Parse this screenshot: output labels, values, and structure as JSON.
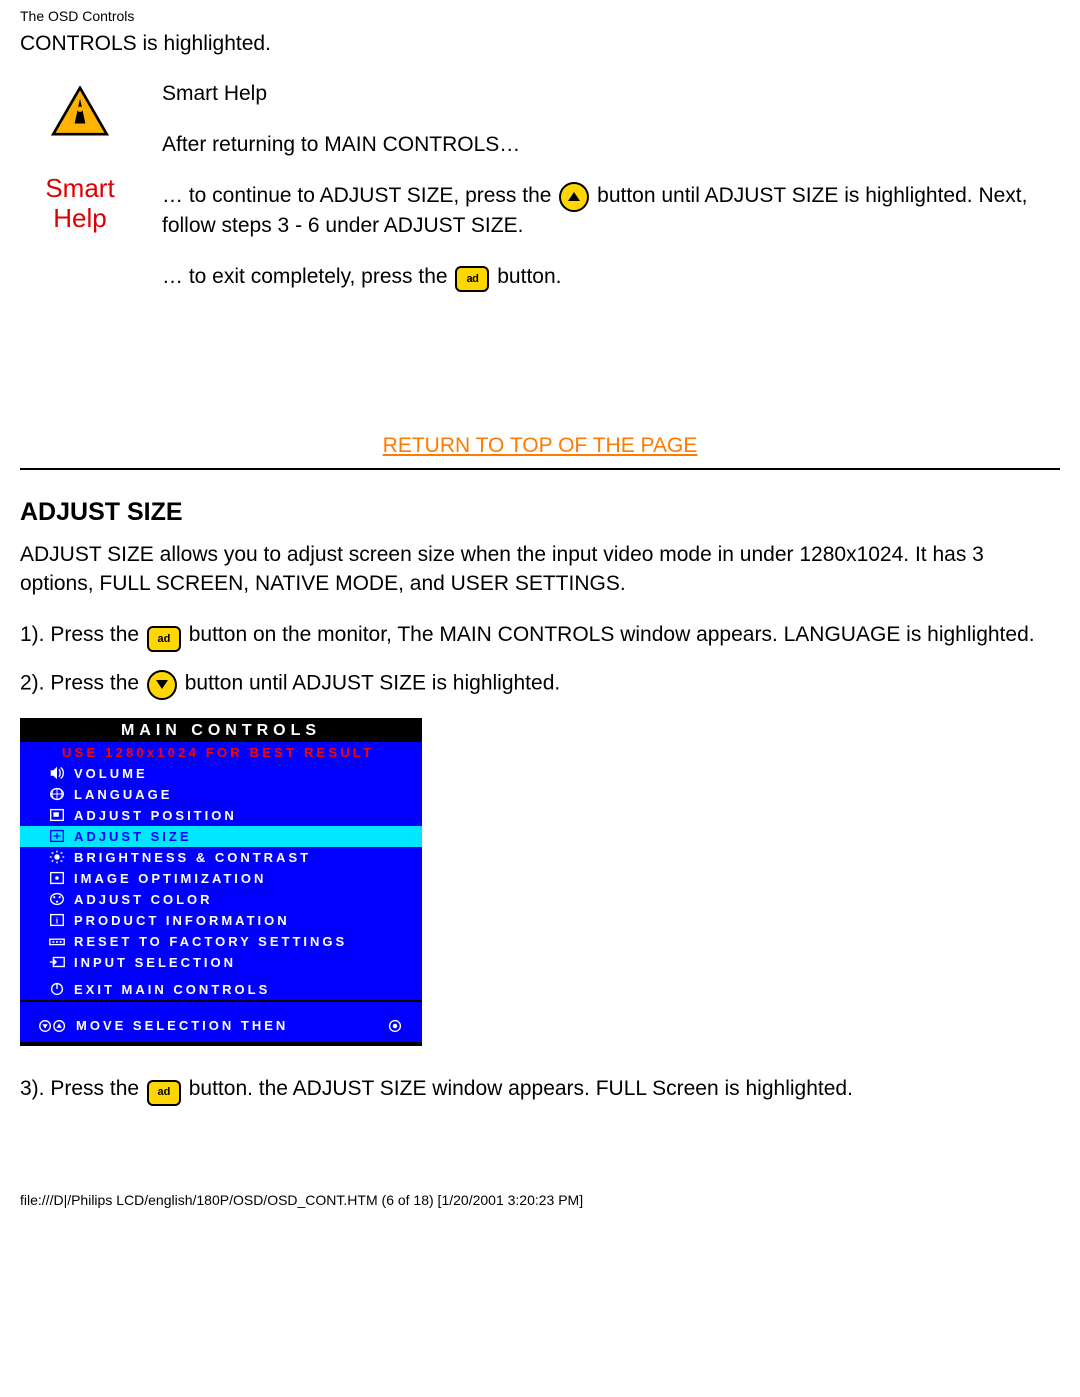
{
  "header": {
    "title": "The OSD Controls"
  },
  "intro_line": "CONTROLS is highlighted.",
  "smart": {
    "label_line1": "Smart",
    "label_line2": "Help",
    "p1": "Smart Help",
    "p2": "After returning to MAIN CONTROLS…",
    "p3a": "… to continue to ADJUST SIZE, press the ",
    "p3b": " button until ADJUST SIZE is highlighted. Next, follow steps 3 - 6 under ADJUST SIZE.",
    "p4a": "… to exit completely, press the ",
    "p4b": " button."
  },
  "return_link": "RETURN TO TOP OF THE PAGE",
  "section": {
    "title": "ADJUST SIZE",
    "desc": "ADJUST SIZE allows you to adjust screen size when the input video mode in under 1280x1024. It has 3 options, FULL SCREEN, NATIVE MODE, and USER SETTINGS.",
    "step1a": "1). Press the ",
    "step1b": "button on the monitor, The MAIN CONTROLS window appears. LANGUAGE is highlighted.",
    "step2a": "2). Press the ",
    "step2b": "button until ADJUST SIZE is highlighted.",
    "step3a": "3). Press the ",
    "step3b": "button. the ADJUST SIZE window appears. FULL Screen is highlighted."
  },
  "osd": {
    "title": "MAIN CONTROLS",
    "hint": "USE 1280x1024 FOR BEST RESULT",
    "items": [
      {
        "label": "VOLUME",
        "hl": false
      },
      {
        "label": "LANGUAGE",
        "hl": false
      },
      {
        "label": "ADJUST POSITION",
        "hl": false
      },
      {
        "label": "ADJUST SIZE",
        "hl": true
      },
      {
        "label": "BRIGHTNESS & CONTRAST",
        "hl": false
      },
      {
        "label": "IMAGE OPTIMIZATION",
        "hl": false
      },
      {
        "label": "ADJUST COLOR",
        "hl": false
      },
      {
        "label": "PRODUCT INFORMATION",
        "hl": false
      },
      {
        "label": "RESET TO FACTORY SETTINGS",
        "hl": false
      },
      {
        "label": "INPUT SELECTION",
        "hl": false
      }
    ],
    "exit": "EXIT MAIN CONTROLS",
    "foot": "MOVE SELECTION THEN"
  },
  "footer": "file:///D|/Philips LCD/english/180P/OSD/OSD_CONT.HTM (6 of 18) [1/20/2001 3:20:23 PM]"
}
